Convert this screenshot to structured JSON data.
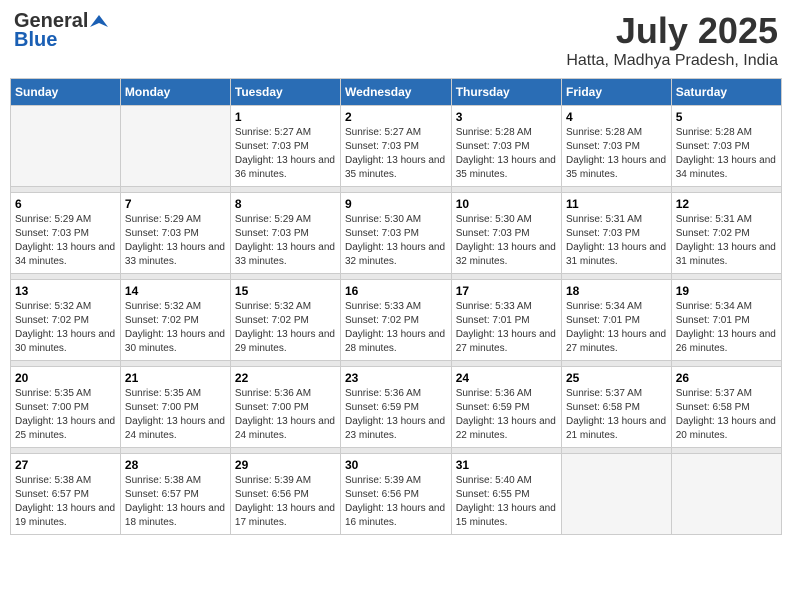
{
  "logo": {
    "general": "General",
    "blue": "Blue"
  },
  "title": "July 2025",
  "subtitle": "Hatta, Madhya Pradesh, India",
  "days_of_week": [
    "Sunday",
    "Monday",
    "Tuesday",
    "Wednesday",
    "Thursday",
    "Friday",
    "Saturday"
  ],
  "weeks": [
    [
      {
        "day": "",
        "info": ""
      },
      {
        "day": "",
        "info": ""
      },
      {
        "day": "1",
        "sunrise": "5:27 AM",
        "sunset": "7:03 PM",
        "daylight": "13 hours and 36 minutes."
      },
      {
        "day": "2",
        "sunrise": "5:27 AM",
        "sunset": "7:03 PM",
        "daylight": "13 hours and 35 minutes."
      },
      {
        "day": "3",
        "sunrise": "5:28 AM",
        "sunset": "7:03 PM",
        "daylight": "13 hours and 35 minutes."
      },
      {
        "day": "4",
        "sunrise": "5:28 AM",
        "sunset": "7:03 PM",
        "daylight": "13 hours and 35 minutes."
      },
      {
        "day": "5",
        "sunrise": "5:28 AM",
        "sunset": "7:03 PM",
        "daylight": "13 hours and 34 minutes."
      }
    ],
    [
      {
        "day": "6",
        "sunrise": "5:29 AM",
        "sunset": "7:03 PM",
        "daylight": "13 hours and 34 minutes."
      },
      {
        "day": "7",
        "sunrise": "5:29 AM",
        "sunset": "7:03 PM",
        "daylight": "13 hours and 33 minutes."
      },
      {
        "day": "8",
        "sunrise": "5:29 AM",
        "sunset": "7:03 PM",
        "daylight": "13 hours and 33 minutes."
      },
      {
        "day": "9",
        "sunrise": "5:30 AM",
        "sunset": "7:03 PM",
        "daylight": "13 hours and 32 minutes."
      },
      {
        "day": "10",
        "sunrise": "5:30 AM",
        "sunset": "7:03 PM",
        "daylight": "13 hours and 32 minutes."
      },
      {
        "day": "11",
        "sunrise": "5:31 AM",
        "sunset": "7:03 PM",
        "daylight": "13 hours and 31 minutes."
      },
      {
        "day": "12",
        "sunrise": "5:31 AM",
        "sunset": "7:02 PM",
        "daylight": "13 hours and 31 minutes."
      }
    ],
    [
      {
        "day": "13",
        "sunrise": "5:32 AM",
        "sunset": "7:02 PM",
        "daylight": "13 hours and 30 minutes."
      },
      {
        "day": "14",
        "sunrise": "5:32 AM",
        "sunset": "7:02 PM",
        "daylight": "13 hours and 30 minutes."
      },
      {
        "day": "15",
        "sunrise": "5:32 AM",
        "sunset": "7:02 PM",
        "daylight": "13 hours and 29 minutes."
      },
      {
        "day": "16",
        "sunrise": "5:33 AM",
        "sunset": "7:02 PM",
        "daylight": "13 hours and 28 minutes."
      },
      {
        "day": "17",
        "sunrise": "5:33 AM",
        "sunset": "7:01 PM",
        "daylight": "13 hours and 27 minutes."
      },
      {
        "day": "18",
        "sunrise": "5:34 AM",
        "sunset": "7:01 PM",
        "daylight": "13 hours and 27 minutes."
      },
      {
        "day": "19",
        "sunrise": "5:34 AM",
        "sunset": "7:01 PM",
        "daylight": "13 hours and 26 minutes."
      }
    ],
    [
      {
        "day": "20",
        "sunrise": "5:35 AM",
        "sunset": "7:00 PM",
        "daylight": "13 hours and 25 minutes."
      },
      {
        "day": "21",
        "sunrise": "5:35 AM",
        "sunset": "7:00 PM",
        "daylight": "13 hours and 24 minutes."
      },
      {
        "day": "22",
        "sunrise": "5:36 AM",
        "sunset": "7:00 PM",
        "daylight": "13 hours and 24 minutes."
      },
      {
        "day": "23",
        "sunrise": "5:36 AM",
        "sunset": "6:59 PM",
        "daylight": "13 hours and 23 minutes."
      },
      {
        "day": "24",
        "sunrise": "5:36 AM",
        "sunset": "6:59 PM",
        "daylight": "13 hours and 22 minutes."
      },
      {
        "day": "25",
        "sunrise": "5:37 AM",
        "sunset": "6:58 PM",
        "daylight": "13 hours and 21 minutes."
      },
      {
        "day": "26",
        "sunrise": "5:37 AM",
        "sunset": "6:58 PM",
        "daylight": "13 hours and 20 minutes."
      }
    ],
    [
      {
        "day": "27",
        "sunrise": "5:38 AM",
        "sunset": "6:57 PM",
        "daylight": "13 hours and 19 minutes."
      },
      {
        "day": "28",
        "sunrise": "5:38 AM",
        "sunset": "6:57 PM",
        "daylight": "13 hours and 18 minutes."
      },
      {
        "day": "29",
        "sunrise": "5:39 AM",
        "sunset": "6:56 PM",
        "daylight": "13 hours and 17 minutes."
      },
      {
        "day": "30",
        "sunrise": "5:39 AM",
        "sunset": "6:56 PM",
        "daylight": "13 hours and 16 minutes."
      },
      {
        "day": "31",
        "sunrise": "5:40 AM",
        "sunset": "6:55 PM",
        "daylight": "13 hours and 15 minutes."
      },
      {
        "day": "",
        "info": ""
      },
      {
        "day": "",
        "info": ""
      }
    ]
  ],
  "labels": {
    "sunrise": "Sunrise:",
    "sunset": "Sunset:",
    "daylight": "Daylight:"
  }
}
